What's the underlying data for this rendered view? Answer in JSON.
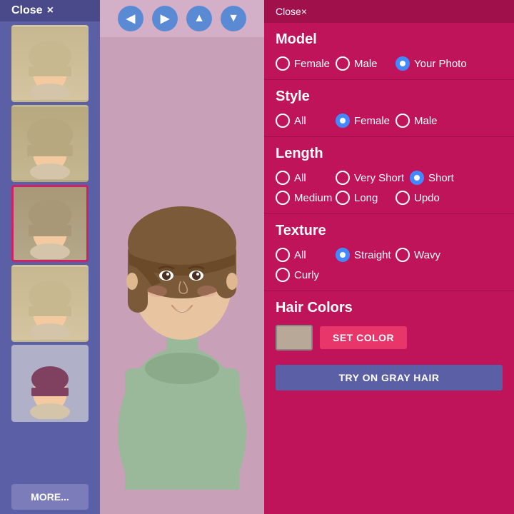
{
  "sidebar": {
    "close_label": "Close",
    "close_x": "×",
    "more_label": "MORE...",
    "thumbnails": [
      {
        "id": 1,
        "alt": "Hair style 1",
        "active": false,
        "hair_color": "#c8b890"
      },
      {
        "id": 2,
        "alt": "Hair style 2",
        "active": false,
        "hair_color": "#b8a880"
      },
      {
        "id": 3,
        "alt": "Hair style 3",
        "active": true,
        "hair_color": "#a89878"
      },
      {
        "id": 4,
        "alt": "Hair style 4",
        "active": false,
        "hair_color": "#c8b890"
      },
      {
        "id": 5,
        "alt": "Hair style 5",
        "active": false,
        "hair_color": "#804060"
      }
    ]
  },
  "nav": {
    "arrows": [
      "◀",
      "▶",
      "▲",
      "▼"
    ]
  },
  "panel": {
    "close_label": "Close",
    "close_x": "×",
    "sections": {
      "model": {
        "title": "Model",
        "options": [
          {
            "id": "female",
            "label": "Female",
            "selected": false
          },
          {
            "id": "male",
            "label": "Male",
            "selected": false
          },
          {
            "id": "your-photo",
            "label": "Your Photo",
            "selected": true
          }
        ]
      },
      "style": {
        "title": "Style",
        "options": [
          {
            "id": "all",
            "label": "All",
            "selected": false
          },
          {
            "id": "female",
            "label": "Female",
            "selected": true
          },
          {
            "id": "male",
            "label": "Male",
            "selected": false
          }
        ]
      },
      "length": {
        "title": "Length",
        "options": [
          {
            "id": "all",
            "label": "All",
            "selected": false
          },
          {
            "id": "very-short",
            "label": "Very Short",
            "selected": false
          },
          {
            "id": "short",
            "label": "Short",
            "selected": true
          },
          {
            "id": "medium",
            "label": "Medium",
            "selected": false
          },
          {
            "id": "long",
            "label": "Long",
            "selected": false
          },
          {
            "id": "updo",
            "label": "Updo",
            "selected": false
          }
        ]
      },
      "texture": {
        "title": "Texture",
        "options": [
          {
            "id": "all",
            "label": "All",
            "selected": false
          },
          {
            "id": "straight",
            "label": "Straight",
            "selected": true
          },
          {
            "id": "wavy",
            "label": "Wavy",
            "selected": false
          },
          {
            "id": "curly",
            "label": "Curly",
            "selected": false
          }
        ]
      },
      "hair_colors": {
        "title": "Hair Colors",
        "swatch_color": "#b8a898",
        "set_color_label": "SET COLOR",
        "try_gray_label": "TRY ON GRAY HAIR"
      }
    }
  }
}
